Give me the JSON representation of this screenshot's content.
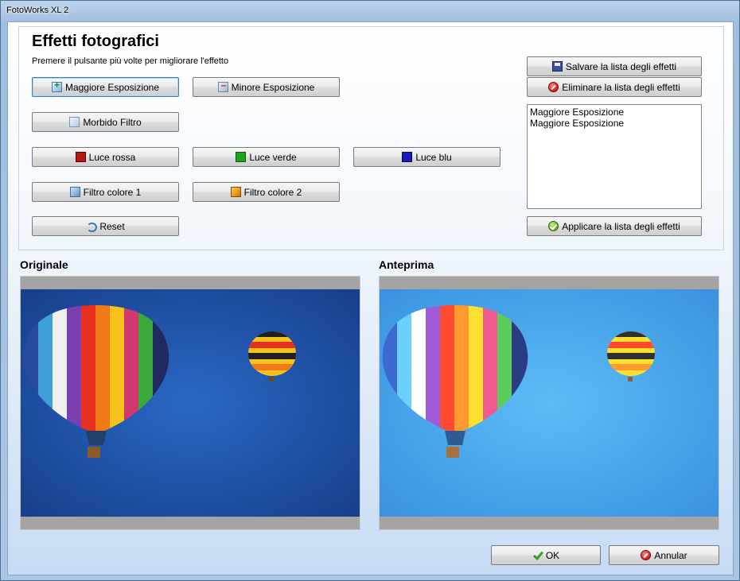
{
  "window": {
    "title": "FotoWorks XL 2"
  },
  "effects": {
    "heading": "Effetti fotografici",
    "hint": "Premere il pulsante più volte per migliorare l'effetto",
    "buttons": {
      "maggiore": "Maggiore Esposizione",
      "minore": "Minore Esposizione",
      "morbido": "Morbido Filtro",
      "rosso": "Luce rossa",
      "verde": "Luce verde",
      "blu": "Luce blu",
      "filtro1": "Filtro colore 1",
      "filtro2": "Filtro colore 2",
      "reset": "Reset"
    }
  },
  "effect_list": {
    "save_label": "Salvare la lista degli effetti",
    "delete_label": "Eliminare la lista degli effetti",
    "apply_label": "Applicare la lista degli effetti",
    "items": [
      "Maggiore Esposizione",
      "Maggiore Esposizione"
    ]
  },
  "panes": {
    "original_label": "Originale",
    "preview_label": "Anteprima"
  },
  "dialog": {
    "ok_label": "OK",
    "cancel_label": "Annular"
  },
  "colors": {
    "original_sky": "#1f56b0",
    "preview_sky": "#47aaf0",
    "frame_gray": "#a4a4a4"
  },
  "icons": {
    "maggiore": "exposure-plus-icon",
    "minore": "exposure-minus-icon",
    "morbido": "soft-filter-icon",
    "rosso": "red-swatch-icon",
    "verde": "green-swatch-icon",
    "blu": "blue-swatch-icon",
    "filtro1": "color-filter-1-icon",
    "filtro2": "color-filter-2-icon",
    "reset": "undo-arrow-icon",
    "save": "floppy-disk-icon",
    "delete": "stop-sign-icon",
    "apply": "green-check-circle-icon",
    "ok": "checkmark-icon",
    "cancel": "stop-sign-icon"
  }
}
